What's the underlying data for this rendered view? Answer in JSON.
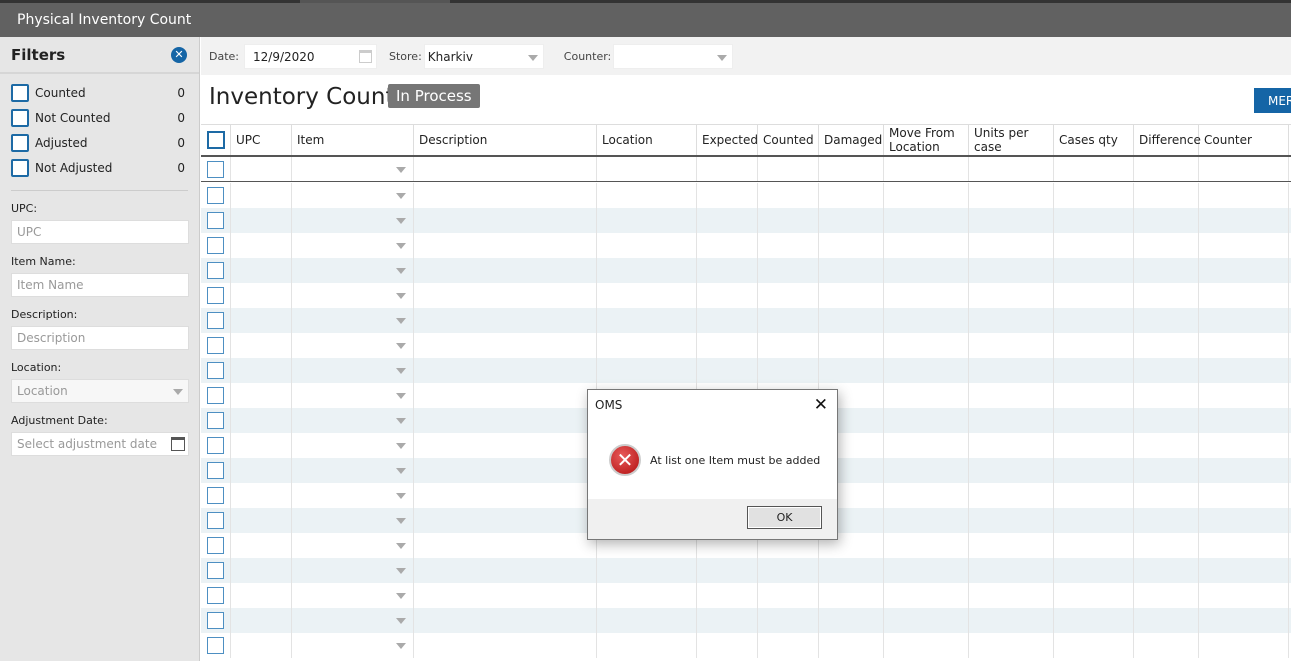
{
  "window": {
    "title": "Physical Inventory Count"
  },
  "filters": {
    "title": "Filters",
    "checks": [
      {
        "label": "Counted",
        "count": "0"
      },
      {
        "label": "Not Counted",
        "count": "0"
      },
      {
        "label": "Adjusted",
        "count": "0"
      },
      {
        "label": "Not Adjusted",
        "count": "0"
      }
    ],
    "upc_label": "UPC:",
    "upc_placeholder": "UPC",
    "item_label": "Item Name:",
    "item_placeholder": "Item Name",
    "desc_label": "Description:",
    "desc_placeholder": "Description",
    "loc_label": "Location:",
    "loc_placeholder": "Location",
    "adj_label": "Adjustment Date:",
    "adj_placeholder": "Select adjustment date"
  },
  "toolbar": {
    "date_label": "Date:",
    "date_value": "12/9/2020",
    "store_label": "Store:",
    "store_value": "Kharkiv",
    "counter_label": "Counter:",
    "counter_value": ""
  },
  "header": {
    "title": "Inventory Count",
    "status": "In Process",
    "button": "MERGE"
  },
  "grid": {
    "columns": [
      "UPC",
      "Item",
      "Description",
      "Location",
      "Expected",
      "Counted",
      "Damaged",
      "Move From Location",
      "Units per case",
      "Cases qty",
      "Difference",
      "Counter"
    ]
  },
  "dialog": {
    "title": "OMS",
    "message": "At list one Item must be added",
    "ok": "OK"
  }
}
